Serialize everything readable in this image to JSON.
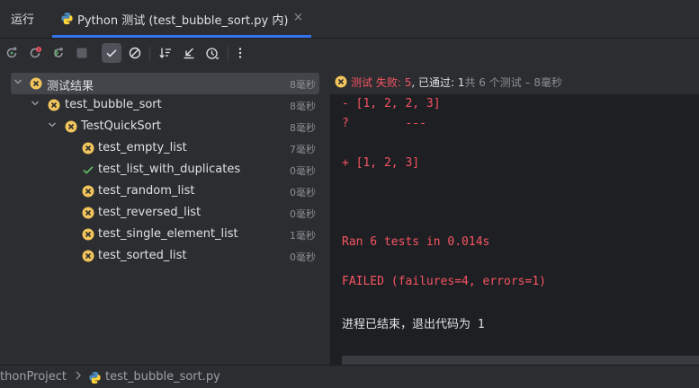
{
  "tool_window": {
    "label": "运行"
  },
  "tab": {
    "title": "Python 测试 (test_bubble_sort.py 内)",
    "close": "×"
  },
  "toolbar": {
    "buttons": [
      "rerun-icon",
      "rerun-failed-icon",
      "toggle-auto-test-icon",
      "stop-icon",
      "show-passed-icon",
      "show-ignored-icon",
      "sort-alphabetically-icon",
      "collapse-icon",
      "sort-by-duration-icon",
      "more-icon"
    ]
  },
  "tree": {
    "items": [
      {
        "name": "测试结果",
        "time": "8毫秒",
        "status": "failed",
        "expanded": true
      },
      {
        "name": "test_bubble_sort",
        "time": "8毫秒",
        "status": "failed",
        "expanded": true
      },
      {
        "name": "TestQuickSort",
        "time": "8毫秒",
        "status": "failed",
        "expanded": true
      },
      {
        "name": "test_empty_list",
        "time": "7毫秒",
        "status": "failed"
      },
      {
        "name": "test_list_with_duplicates",
        "time": "0毫秒",
        "status": "passed"
      },
      {
        "name": "test_random_list",
        "time": "0毫秒",
        "status": "failed"
      },
      {
        "name": "test_reversed_list",
        "time": "0毫秒",
        "status": "failed"
      },
      {
        "name": "test_single_element_list",
        "time": "1毫秒",
        "status": "failed"
      },
      {
        "name": "test_sorted_list",
        "time": "0毫秒",
        "status": "failed"
      }
    ]
  },
  "console": {
    "summary": {
      "failed_label": "测试 失败: ",
      "failed_count": "5",
      "passed_label": ", 已通过: ",
      "passed_count": "1",
      "total_text": "共 6 个测试 – 8毫秒"
    },
    "lines": [
      "- [1, 2, 2, 3]",
      "?        ---",
      "+ [1, 2, 3]",
      "Ran 6 tests in 0.014s",
      "FAILED (failures=4, errors=1)",
      "进程已结束，退出代码为 1"
    ]
  },
  "statusbar": {
    "project": "thonProject",
    "file": "test_bubble_sort.py"
  },
  "colors": {
    "fail": "#f75464",
    "pass": "#5fb865",
    "warn": "#f2c55c",
    "accent": "#3574f0"
  }
}
